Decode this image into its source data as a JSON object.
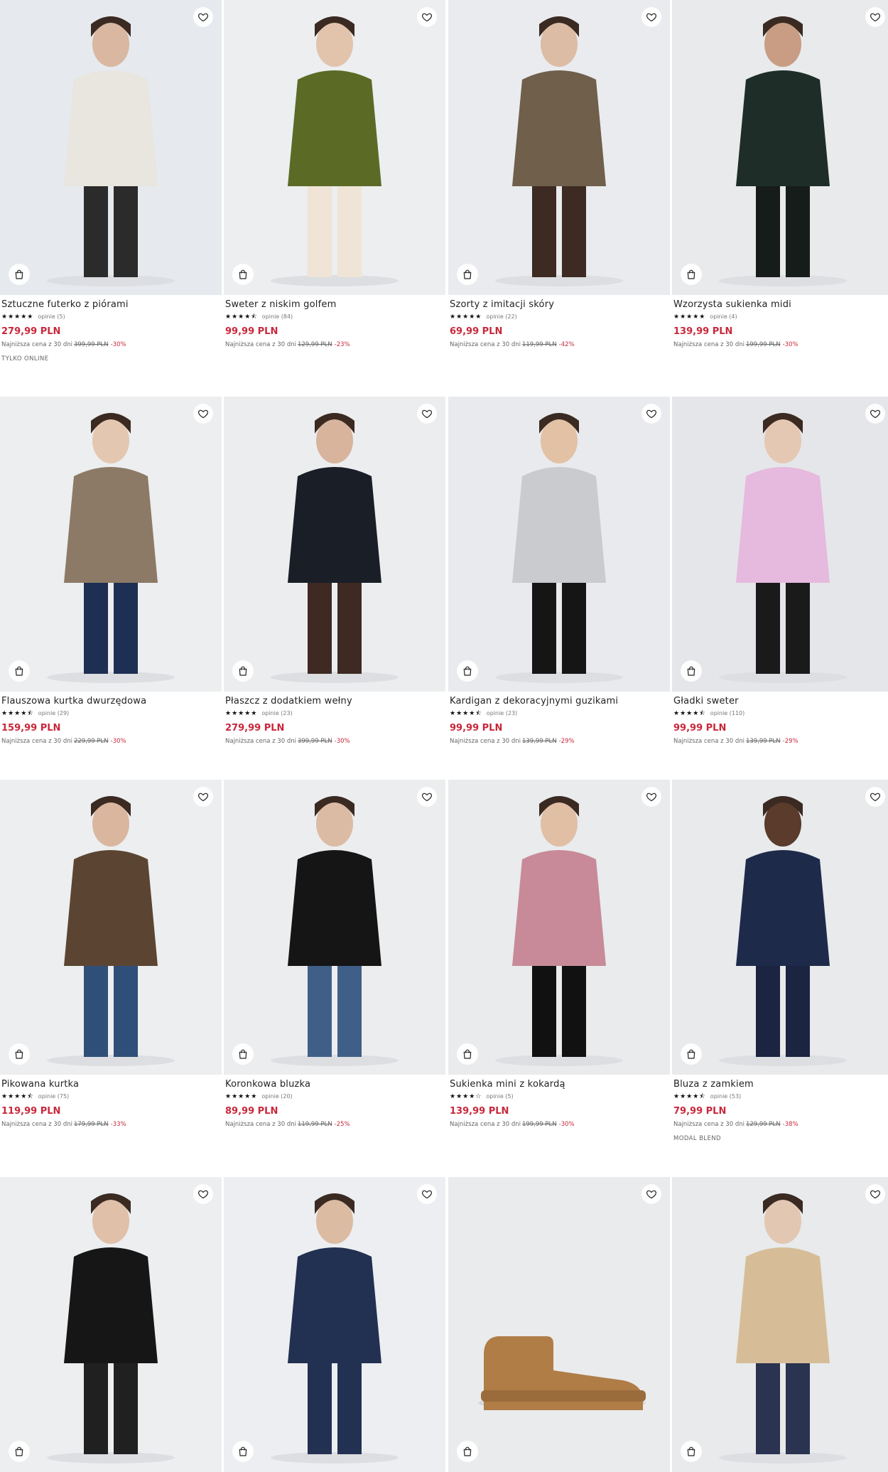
{
  "lowest_prefix": "Najniższa cena z 30 dni",
  "products": [
    {
      "name": "Sztuczne futerko z piórami",
      "stars": "★★★★★",
      "reviews": "opinie (5)",
      "price": "279,99 PLN",
      "old_price": "399,99 PLN",
      "discount": "-30%",
      "tag": "TYLKO ONLINE"
    },
    {
      "name": "Sweter z niskim golfem",
      "stars": "★★★★⯪",
      "reviews": "opinie (84)",
      "price": "99,99 PLN",
      "old_price": "129,99 PLN",
      "discount": "-23%",
      "tag": ""
    },
    {
      "name": "Szorty z imitacji skóry",
      "stars": "★★★★★",
      "reviews": "opinie (22)",
      "price": "69,99 PLN",
      "old_price": "119,99 PLN",
      "discount": "-42%",
      "tag": ""
    },
    {
      "name": "Wzorzysta sukienka midi",
      "stars": "★★★★★",
      "reviews": "opinie (4)",
      "price": "139,99 PLN",
      "old_price": "199,99 PLN",
      "discount": "-30%",
      "tag": ""
    },
    {
      "name": "Flauszowa kurtka dwurzędowa",
      "stars": "★★★★⯪",
      "reviews": "opinie (29)",
      "price": "159,99 PLN",
      "old_price": "229,99 PLN",
      "discount": "-30%",
      "tag": ""
    },
    {
      "name": "Płaszcz z dodatkiem wełny",
      "stars": "★★★★★",
      "reviews": "opinie (23)",
      "price": "279,99 PLN",
      "old_price": "399,99 PLN",
      "discount": "-30%",
      "tag": ""
    },
    {
      "name": "Kardigan z dekoracyjnymi guzikami",
      "stars": "★★★★⯪",
      "reviews": "opinie (23)",
      "price": "99,99 PLN",
      "old_price": "139,99 PLN",
      "discount": "-29%",
      "tag": ""
    },
    {
      "name": "Gładki sweter",
      "stars": "★★★★⯪",
      "reviews": "opinie (110)",
      "price": "99,99 PLN",
      "old_price": "139,99 PLN",
      "discount": "-29%",
      "tag": ""
    },
    {
      "name": "Pikowana kurtka",
      "stars": "★★★★⯪",
      "reviews": "opinie (75)",
      "price": "119,99 PLN",
      "old_price": "179,99 PLN",
      "discount": "-33%",
      "tag": ""
    },
    {
      "name": "Koronkowa bluzka",
      "stars": "★★★★★",
      "reviews": "opinie (20)",
      "price": "89,99 PLN",
      "old_price": "119,99 PLN",
      "discount": "-25%",
      "tag": ""
    },
    {
      "name": "Sukienka mini z kokardą",
      "stars": "★★★★☆",
      "reviews": "opinie (5)",
      "price": "139,99 PLN",
      "old_price": "199,99 PLN",
      "discount": "-30%",
      "tag": ""
    },
    {
      "name": "Bluza z zamkiem",
      "stars": "★★★★⯪",
      "reviews": "opinie (53)",
      "price": "79,99 PLN",
      "old_price": "129,99 PLN",
      "discount": "-38%",
      "tag": "MODAL BLEND"
    }
  ],
  "images": [
    {
      "bg": "#e6e9ed",
      "main": "#e9e5df",
      "accent": "#2b2b2b",
      "skin": "#d9b7a0",
      "icon": "faux-fur-jacket"
    },
    {
      "bg": "#eceef0",
      "main": "#5b6b26",
      "accent": "#efe4d6",
      "skin": "#e2c4ad",
      "icon": "green-sweater"
    },
    {
      "bg": "#e9ebee",
      "main": "#6f5f4b",
      "accent": "#3d2a22",
      "skin": "#dcbca4",
      "icon": "leather-shorts"
    },
    {
      "bg": "#e8eaec",
      "main": "#1f2d28",
      "accent": "#151c19",
      "skin": "#c89d84",
      "icon": "midi-dress"
    },
    {
      "bg": "#eceeef",
      "main": "#8c7a67",
      "accent": "#1d2f52",
      "skin": "#e4c7b0",
      "icon": "double-breasted-jacket"
    },
    {
      "bg": "#ecedef",
      "main": "#1a1e27",
      "accent": "#3e2a22",
      "skin": "#d8b49c",
      "icon": "wool-coat"
    },
    {
      "bg": "#e8eaed",
      "main": "#c9cbcf",
      "accent": "#151515",
      "skin": "#e2c1a5",
      "icon": "cardigan"
    },
    {
      "bg": "#e5e6e9",
      "main": "#e6b9de",
      "accent": "#1a1a1a",
      "skin": "#e5c8b3",
      "icon": "pink-sweater"
    },
    {
      "bg": "#eceef0",
      "main": "#5b4532",
      "accent": "#2f4f79",
      "skin": "#dab69f",
      "icon": "puffer-jacket"
    },
    {
      "bg": "#ecedef",
      "main": "#151515",
      "accent": "#3f5f88",
      "skin": "#dcbba4",
      "icon": "lace-blouse"
    },
    {
      "bg": "#e9ebed",
      "main": "#c88a98",
      "accent": "#111111",
      "skin": "#e0bfa5",
      "icon": "sequin-dress"
    },
    {
      "bg": "#e8eaec",
      "main": "#1e2a4a",
      "accent": "#1b2440",
      "skin": "#5a3b2c",
      "icon": "zip-sweatshirt"
    },
    {
      "bg": "#eceef0",
      "main": "#161616",
      "accent": "#202020",
      "skin": "#e0c0a8",
      "icon": "black-trousers"
    },
    {
      "bg": "#eceef1",
      "main": "#223052",
      "accent": "#223052",
      "skin": "#dcbba3",
      "icon": "navy-blazer"
    },
    {
      "bg": "#e9ebed",
      "main": "#b07d47",
      "accent": "#9a6b3b",
      "skin": "#e9ebed",
      "icon": "suede-boots"
    },
    {
      "bg": "#e8eaec",
      "main": "#d6bd97",
      "accent": "#2a3350",
      "skin": "#e2c7b2",
      "icon": "trench-coat"
    }
  ],
  "icons": {
    "favorite": "heart-icon",
    "cart": "shopping-bag-icon"
  },
  "colors": {
    "price": "#c8283b",
    "text": "#1a1a1a",
    "muted": "#666666"
  }
}
